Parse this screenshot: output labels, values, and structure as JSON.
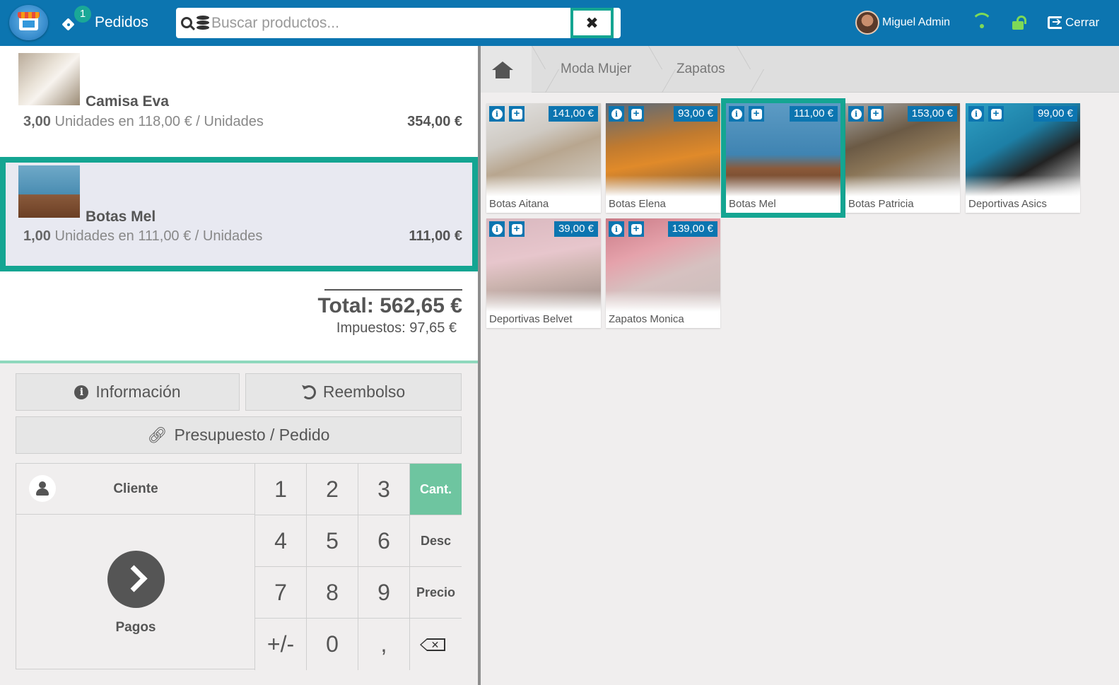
{
  "topbar": {
    "orders_badge": "1",
    "orders_label": "Pedidos",
    "search_placeholder": "Buscar productos...",
    "clear_symbol": "✖",
    "user_name": "Miguel Admin",
    "logout_label": "Cerrar"
  },
  "order": {
    "lines": [
      {
        "name": "Camisa Eva",
        "qty": "3,00",
        "detail": " Unidades en 118,00 € / Unidades",
        "price": "354,00 €"
      },
      {
        "name": "Botas Mel",
        "qty": "1,00",
        "detail": " Unidades en 111,00 € / Unidades",
        "price": "111,00 €"
      }
    ],
    "total": "Total: 562,65 €",
    "taxes": "Impuestos: 97,65 €"
  },
  "actions": {
    "info_label": "Información",
    "refund_label": "Reembolso",
    "quote_label": "Presupuesto / Pedido"
  },
  "numpad": {
    "customer_label": "Cliente",
    "pay_label": "Pagos",
    "keys": [
      "1",
      "2",
      "3",
      "4",
      "5",
      "6",
      "7",
      "8",
      "9",
      "+/-",
      "0",
      ","
    ],
    "modes": [
      "Cant.",
      "Desc",
      "Precio"
    ],
    "active_mode": "Cant."
  },
  "breadcrumb": {
    "items": [
      "Moda Mujer",
      "Zapatos"
    ]
  },
  "products": [
    {
      "name": "Botas Aitana",
      "price": "141,00 €"
    },
    {
      "name": "Botas Elena",
      "price": "93,00 €"
    },
    {
      "name": "Botas Mel",
      "price": "111,00 €"
    },
    {
      "name": "Botas Patricia",
      "price": "153,00 €"
    },
    {
      "name": "Deportivas Asics",
      "price": "99,00 €"
    },
    {
      "name": "Deportivas Belvet",
      "price": "39,00 €"
    },
    {
      "name": "Zapatos Monica",
      "price": "139,00 €"
    }
  ],
  "colors": {
    "topbar": "#0c75b0",
    "accent": "#14a592",
    "active_key": "#6ec5a0",
    "price_tag": "#0c75b0"
  }
}
